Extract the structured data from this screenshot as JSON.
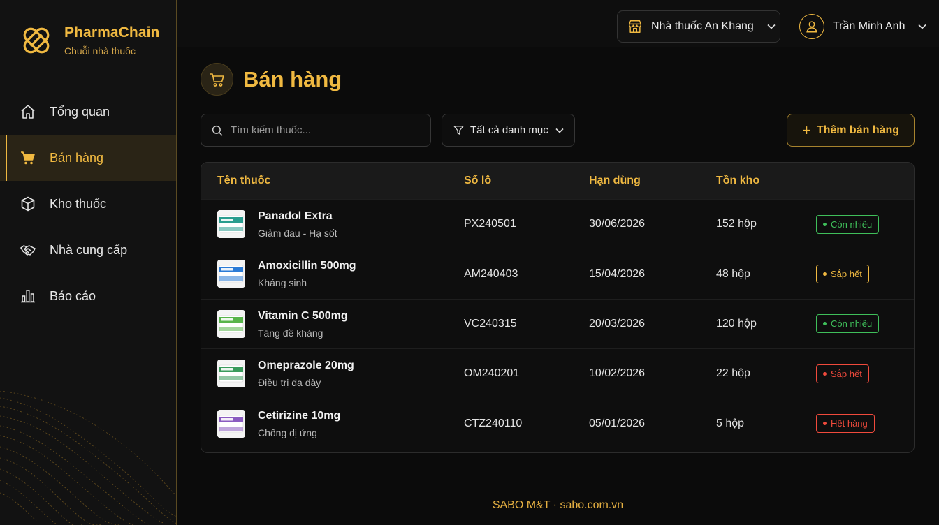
{
  "brand": {
    "name": "PharmaChain",
    "subtitle": "Chuỗi nhà thuốc"
  },
  "nav": [
    {
      "label": "Tổng quan",
      "icon": "home-icon",
      "active": false
    },
    {
      "label": "Bán hàng",
      "icon": "cart-icon",
      "active": true
    },
    {
      "label": "Kho thuốc",
      "icon": "box-icon",
      "active": false
    },
    {
      "label": "Nhà cung cấp",
      "icon": "handshake-icon",
      "active": false
    },
    {
      "label": "Báo cáo",
      "icon": "bar-chart-icon",
      "active": false
    }
  ],
  "topbar": {
    "store": "Nhà thuốc An Khang",
    "user": "Trần Minh Anh"
  },
  "page": {
    "title": "Bán hàng"
  },
  "toolbar": {
    "search_placeholder": "Tìm kiếm thuốc...",
    "filter_label": "Tất cả danh mục",
    "add_label": "Thêm bán hàng"
  },
  "table": {
    "headers": [
      "Tên thuốc",
      "Số lô",
      "Hạn dùng",
      "Tồn kho"
    ],
    "rows": [
      {
        "name": "Panadol Extra",
        "category": "Giảm đau - Hạ sốt",
        "lot": "PX240501",
        "expiry": "30/06/2026",
        "stock": "152 hộp",
        "status": "Còn nhiều",
        "status_type": "ok"
      },
      {
        "name": "Amoxicillin 500mg",
        "category": "Kháng sinh",
        "lot": "AM240403",
        "expiry": "15/04/2026",
        "stock": "48 hộp",
        "status": "Sắp hết",
        "status_type": "warn"
      },
      {
        "name": "Vitamin C 500mg",
        "category": "Tăng đề kháng",
        "lot": "VC240315",
        "expiry": "20/03/2026",
        "stock": "120 hộp",
        "status": "Còn nhiều",
        "status_type": "ok"
      },
      {
        "name": "Omeprazole 20mg",
        "category": "Điều trị dạ dày",
        "lot": "OM240201",
        "expiry": "10/02/2026",
        "stock": "22 hộp",
        "status": "Sắp hết",
        "status_type": "danger"
      },
      {
        "name": "Cetirizine 10mg",
        "category": "Chống dị ứng",
        "lot": "CTZ240110",
        "expiry": "05/01/2026",
        "stock": "5 hộp",
        "status": "Hết hàng",
        "status_type": "danger"
      }
    ]
  },
  "footer": {
    "text": "SABO M&T · sabo.com.vn"
  },
  "colors": {
    "accent": "#f0b941",
    "ok": "#3fbf5a",
    "warn": "#f0b941",
    "danger": "#f04a3c"
  }
}
